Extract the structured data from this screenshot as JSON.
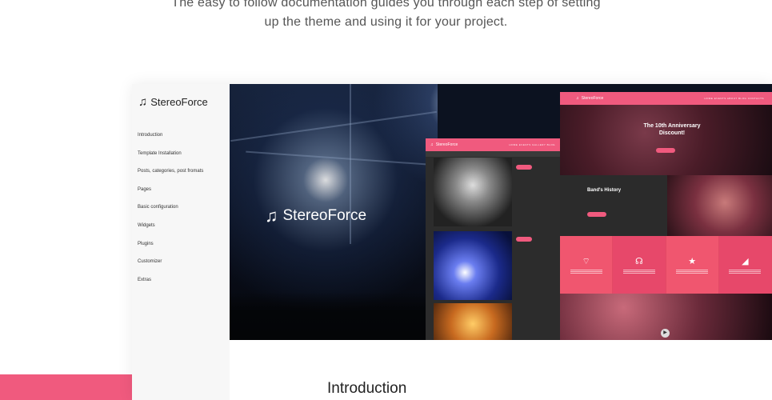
{
  "intro": {
    "line1": "The easy to follow documentation guides you through each step of setting",
    "line2": "up the theme and using it for your project."
  },
  "sidebar": {
    "brand": "StereoForce",
    "items": [
      {
        "label": "Introduction"
      },
      {
        "label": "Template Installation"
      },
      {
        "label": "Posts, categories, post fromats"
      },
      {
        "label": "Pages"
      },
      {
        "label": "Basic configuration"
      },
      {
        "label": "Widgets"
      },
      {
        "label": "Plugins"
      },
      {
        "label": "Customizer"
      },
      {
        "label": "Extras"
      }
    ]
  },
  "hero": {
    "brand": "StereoForce",
    "mock_blog": {
      "brand": "StereoForce",
      "nav": "HOME  EVENTS  GALLERY  BLOG"
    },
    "mock_home": {
      "brand": "StereoForce",
      "nav": "HOME  EVENTS  ABOUT  BLOG  CONTACTS",
      "headline": "The 10th Anniversary Discount!",
      "section": "Band's History"
    }
  },
  "content": {
    "heading": "Introduction"
  },
  "colors": {
    "accent": "#f05a7e",
    "sidebar_bg": "#f7f7f7"
  }
}
